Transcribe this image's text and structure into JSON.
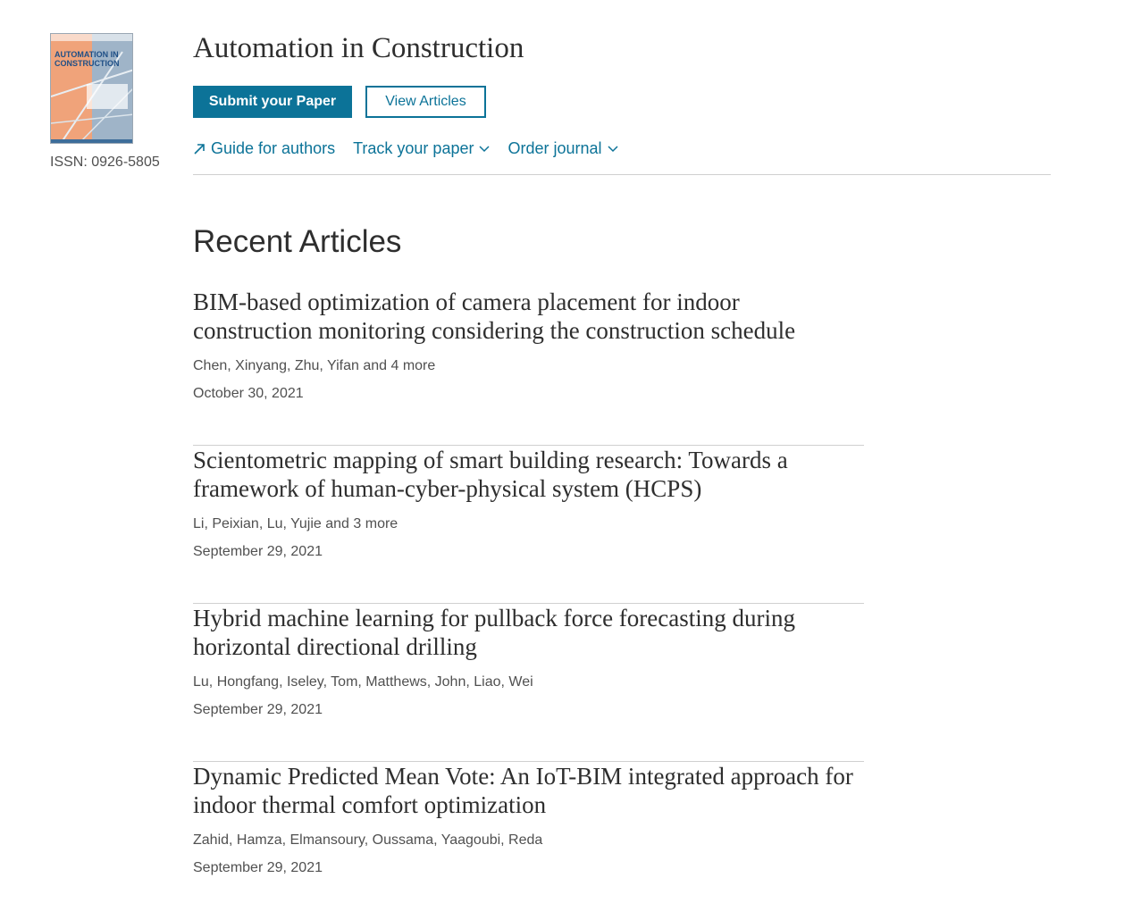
{
  "journal": {
    "title": "Automation in Construction",
    "issn": "ISSN: 0926-5805",
    "cover_title": "AUTOMATION IN CONSTRUCTION"
  },
  "actions": {
    "submit_label": "Submit your Paper",
    "view_label": "View Articles"
  },
  "links": {
    "guide_label": "Guide for authors",
    "track_label": "Track your paper",
    "order_label": "Order journal"
  },
  "recent": {
    "heading": "Recent Articles",
    "articles": [
      {
        "title": "BIM-based optimization of camera placement for indoor construction monitoring considering the construction schedule",
        "authors": "Chen, Xinyang, Zhu, Yifan and 4 more",
        "date": "October 30, 2021"
      },
      {
        "title": "Scientometric mapping of smart building research: Towards a framework of human-cyber-physical system (HCPS)",
        "authors": "Li, Peixian, Lu, Yujie and 3 more",
        "date": "September 29, 2021"
      },
      {
        "title": "Hybrid machine learning for pullback force forecasting during horizontal directional drilling",
        "authors": "Lu, Hongfang, Iseley, Tom, Matthews, John, Liao, Wei",
        "date": "September 29, 2021"
      },
      {
        "title": "Dynamic Predicted Mean Vote: An IoT-BIM integrated approach for indoor thermal comfort optimization",
        "authors": "Zahid, Hamza, Elmansoury, Oussama, Yaagoubi, Reda",
        "date": "September 29, 2021"
      }
    ]
  },
  "colors": {
    "accent": "#0c7398",
    "text": "#2e2e2e",
    "muted": "#505050",
    "divider": "#d0d0d0",
    "cover_orange": "#f0a37a",
    "cover_blue": "#9fb4c8"
  }
}
